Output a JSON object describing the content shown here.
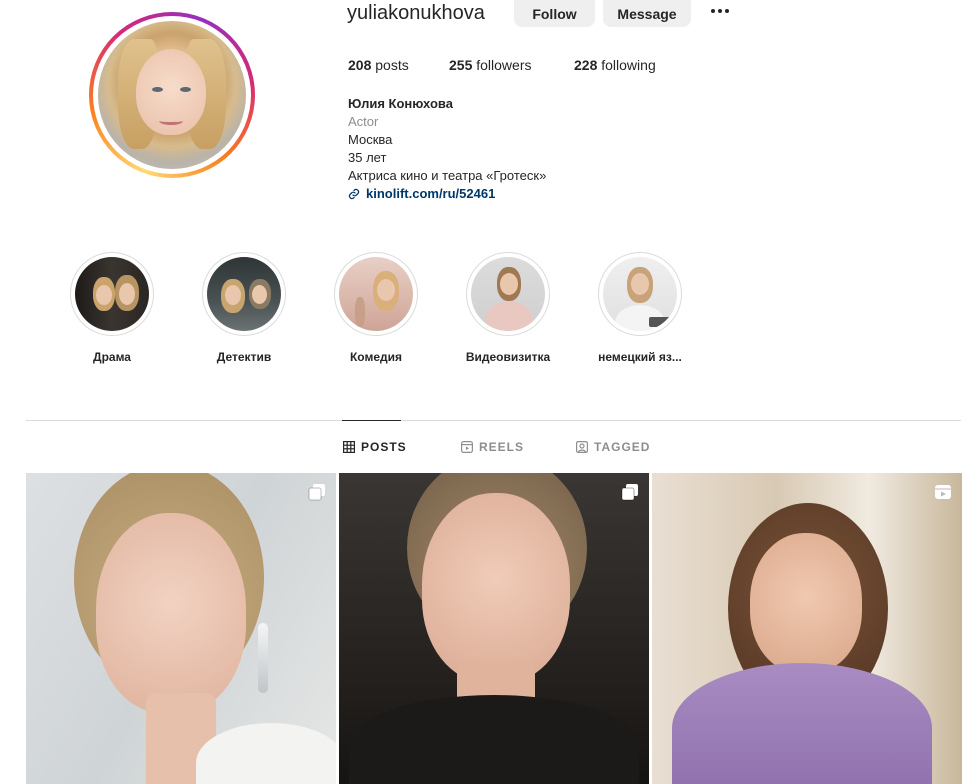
{
  "profile": {
    "username": "yuliakonukhova",
    "follow_label": "Follow",
    "message_label": "Message",
    "more_icon": "more-horizontal-icon"
  },
  "stats": {
    "posts_count": "208",
    "posts_label": " posts",
    "followers_count": "255",
    "followers_label": " followers",
    "following_count": "228",
    "following_label": " following"
  },
  "bio": {
    "name": "Юлия Конюхова",
    "category": "Actor",
    "line1": "Москва",
    "line2": "35 лет",
    "line3": "Актриса кино и театра «Гротеск»",
    "link": "kinolift.com/ru/52461"
  },
  "highlights": [
    {
      "label": "Драма"
    },
    {
      "label": "Детектив"
    },
    {
      "label": "Комедия"
    },
    {
      "label": "Видеовизитка"
    },
    {
      "label": "немецкий яз..."
    }
  ],
  "tabs": [
    {
      "label": "POSTS",
      "icon": "grid-icon",
      "active": true
    },
    {
      "label": "REELS",
      "icon": "reels-icon",
      "active": false
    },
    {
      "label": "TAGGED",
      "icon": "tagged-icon",
      "active": false
    }
  ],
  "posts": [
    {
      "type": "carousel",
      "icon": "carousel-icon"
    },
    {
      "type": "carousel",
      "icon": "carousel-icon"
    },
    {
      "type": "reel",
      "icon": "reels-icon"
    }
  ],
  "colors": {
    "link": "#00376b",
    "muted": "#8e8e8e",
    "button_bg": "#efefef"
  }
}
